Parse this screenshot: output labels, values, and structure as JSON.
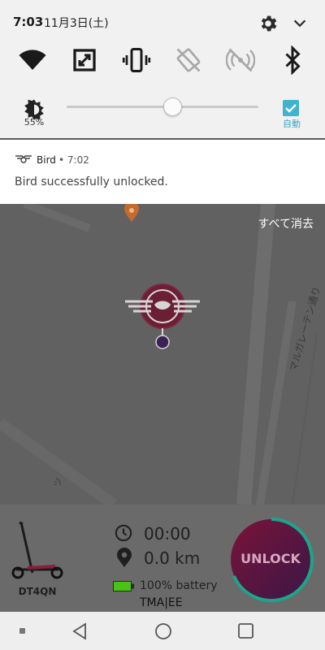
{
  "status_bar": {
    "time": "7:03",
    "date": "11月3日(土)",
    "icons": [
      "gear-icon",
      "chevron-down-icon"
    ]
  },
  "quick_settings": {
    "tiles": [
      "wifi-icon",
      "screen-rotate-icon",
      "vibrate-icon",
      "auto-rotate-off-icon",
      "mobile-data-off-icon",
      "bluetooth-icon"
    ],
    "brightness_percent": "55%",
    "brightness_level": 0.55,
    "auto_brightness_label": "自動",
    "auto_brightness_checked": true
  },
  "notification": {
    "app_name": "Bird",
    "time": "• 7:02",
    "message": "Bird successfully unlocked."
  },
  "map": {
    "clear_all_label": "すべて消去",
    "street_name": "マルガレーテン通り",
    "street_small": "ツ"
  },
  "ride_card": {
    "scooter_id": "DT4QN",
    "timer": "00:00",
    "distance": "0.0 km",
    "battery": "100% battery",
    "plate": "TMA|EE",
    "unlock_label": "UNLOCK"
  },
  "nav_bar": {
    "buttons": [
      "square-dot-icon",
      "back-icon",
      "home-icon",
      "recents-icon"
    ]
  },
  "colors": {
    "accent": "#3fb3cf",
    "unlock_gradient_start": "#7a1438",
    "unlock_gradient_end": "#3a1648",
    "unlock_ring": "#1aa68a",
    "battery_green": "#49c414"
  }
}
